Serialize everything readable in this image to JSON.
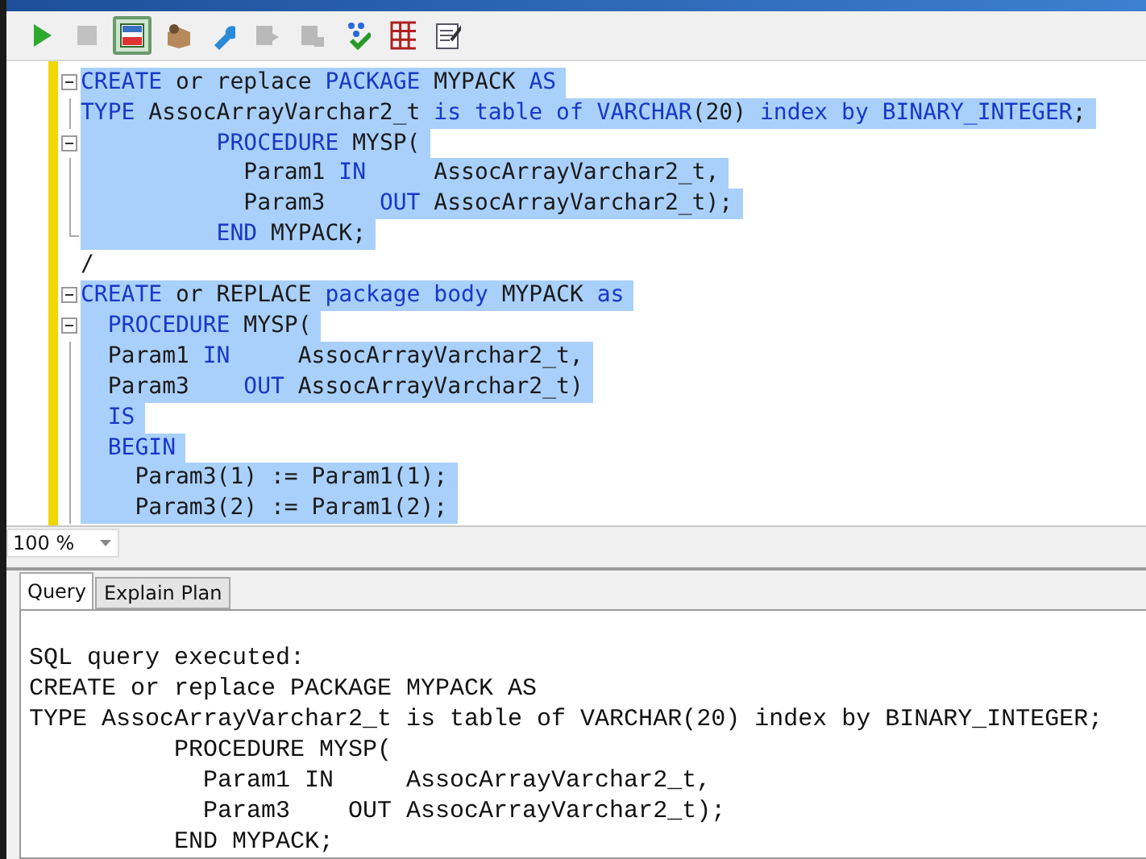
{
  "toolbar": [
    {
      "kind": "run",
      "pressed": false,
      "disabled": false
    },
    {
      "kind": "stop",
      "pressed": false,
      "disabled": true
    },
    {
      "kind": "results",
      "pressed": true,
      "disabled": false
    },
    {
      "kind": "package",
      "pressed": false,
      "disabled": false
    },
    {
      "kind": "wrench",
      "pressed": false,
      "disabled": false
    },
    {
      "kind": "step",
      "pressed": false,
      "disabled": true
    },
    {
      "kind": "step2",
      "pressed": false,
      "disabled": true
    },
    {
      "kind": "dots",
      "pressed": false,
      "disabled": false
    },
    {
      "kind": "grid",
      "pressed": false,
      "disabled": false
    },
    {
      "kind": "note",
      "pressed": false,
      "disabled": false
    }
  ],
  "editor": {
    "lines": [
      {
        "kind": "start",
        "selected": true,
        "tokens": [
          {
            "text": "CREATE",
            "kind": "kw"
          },
          {
            "text": " or replace ",
            "kind": "plain"
          },
          {
            "text": "PACKAGE",
            "kind": "kw"
          },
          {
            "text": " MYPACK ",
            "kind": "plain"
          },
          {
            "text": "AS",
            "kind": "kw"
          }
        ]
      },
      {
        "kind": "inner",
        "selected": true,
        "tokens": [
          {
            "text": "TYPE",
            "kind": "kw"
          },
          {
            "text": " AssocArrayVarchar2_t ",
            "kind": "plain"
          },
          {
            "text": "is table of VARCHAR",
            "kind": "kw"
          },
          {
            "text": "(20) ",
            "kind": "plain"
          },
          {
            "text": "index by BINARY_INTEGER",
            "kind": "kw"
          },
          {
            "text": ";",
            "kind": "plain"
          }
        ]
      },
      {
        "kind": "start",
        "selected": true,
        "tokens": [
          {
            "text": "          PROCEDURE",
            "kind": "kw"
          },
          {
            "text": " MYSP(",
            "kind": "plain"
          }
        ]
      },
      {
        "kind": "inner",
        "selected": true,
        "tokens": [
          {
            "text": "            Param1 ",
            "kind": "plain"
          },
          {
            "text": "IN",
            "kind": "kw"
          },
          {
            "text": "     AssocArrayVarchar2_t,",
            "kind": "plain"
          }
        ]
      },
      {
        "kind": "inner",
        "selected": true,
        "tokens": [
          {
            "text": "            Param3    ",
            "kind": "plain"
          },
          {
            "text": "OUT",
            "kind": "kw"
          },
          {
            "text": " AssocArrayVarchar2_t);",
            "kind": "plain"
          }
        ]
      },
      {
        "kind": "end",
        "selected": true,
        "tokens": [
          {
            "text": "          END",
            "kind": "kw"
          },
          {
            "text": " MYPACK;",
            "kind": "plain"
          }
        ]
      },
      {
        "kind": "outside",
        "selected": false,
        "tokens": [
          {
            "text": "/",
            "kind": "plain"
          }
        ]
      },
      {
        "kind": "start",
        "selected": true,
        "tokens": [
          {
            "text": "CREATE",
            "kind": "kw"
          },
          {
            "text": " or REPLACE ",
            "kind": "plain"
          },
          {
            "text": "package body",
            "kind": "kw"
          },
          {
            "text": " MYPACK ",
            "kind": "plain"
          },
          {
            "text": "as",
            "kind": "kw"
          }
        ]
      },
      {
        "kind": "start",
        "selected": true,
        "tokens": [
          {
            "text": "  PROCEDURE",
            "kind": "kw"
          },
          {
            "text": " MYSP(",
            "kind": "plain"
          }
        ]
      },
      {
        "kind": "inner",
        "selected": true,
        "tokens": [
          {
            "text": "  Param1 ",
            "kind": "plain"
          },
          {
            "text": "IN",
            "kind": "kw"
          },
          {
            "text": "     AssocArrayVarchar2_t,",
            "kind": "plain"
          }
        ]
      },
      {
        "kind": "inner",
        "selected": true,
        "tokens": [
          {
            "text": "  Param3    ",
            "kind": "plain"
          },
          {
            "text": "OUT",
            "kind": "kw"
          },
          {
            "text": " AssocArrayVarchar2_t)",
            "kind": "plain"
          }
        ]
      },
      {
        "kind": "inner",
        "selected": true,
        "tokens": [
          {
            "text": "  IS",
            "kind": "kw"
          }
        ]
      },
      {
        "kind": "inner",
        "selected": true,
        "tokens": [
          {
            "text": "  BEGIN",
            "kind": "kw"
          }
        ]
      },
      {
        "kind": "inner",
        "selected": true,
        "tokens": [
          {
            "text": "    Param3(1) := Param1(1);",
            "kind": "plain"
          }
        ]
      },
      {
        "kind": "inner",
        "selected": true,
        "tokens": [
          {
            "text": "    Param3(2) := Param1(2);",
            "kind": "plain"
          }
        ]
      }
    ]
  },
  "zoom": {
    "value": "100 %"
  },
  "output": {
    "tabs": [
      {
        "label": "Query",
        "selected": true
      },
      {
        "label": "Explain Plan",
        "selected": false
      }
    ],
    "lines": [
      "SQL query executed:",
      "CREATE or replace PACKAGE MYPACK AS",
      "TYPE AssocArrayVarchar2_t is table of VARCHAR(20) index by BINARY_INTEGER;",
      "          PROCEDURE MYSP(",
      "            Param1 IN     AssocArrayVarchar2_t,",
      "            Param3    OUT AssocArrayVarchar2_t);",
      "          END MYPACK;"
    ]
  }
}
